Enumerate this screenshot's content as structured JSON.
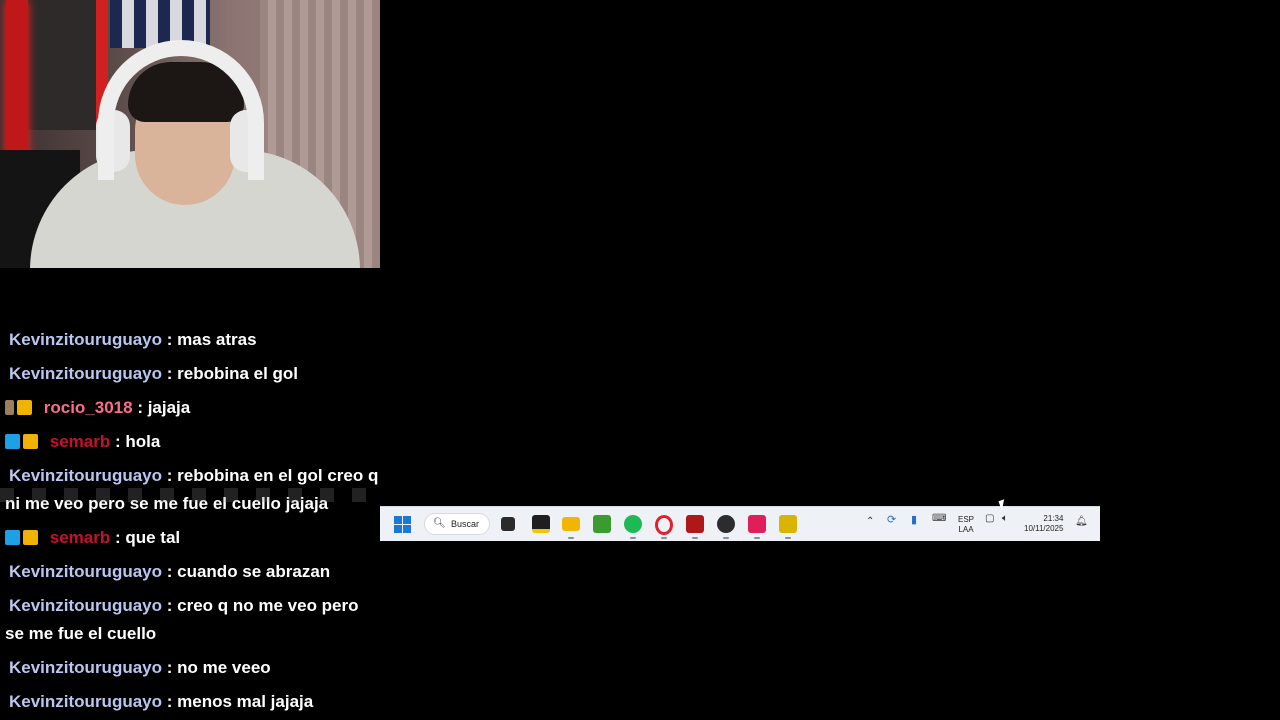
{
  "chat": {
    "messages": [
      {
        "user": "Kevinzitouruguayo",
        "text": ": mas atras"
      },
      {
        "user": "Kevinzitouruguayo",
        "text": ": rebobina el gol"
      },
      {
        "user": "rocio_3018",
        "text": ": jajaja"
      },
      {
        "user": "semarb",
        "text": ": hola"
      },
      {
        "user": "Kevinzitouruguayo",
        "text": ": rebobina en el gol creo q ni me veo pero se me fue el cuello jajaja"
      },
      {
        "user": "semarb",
        "text": ": que tal"
      },
      {
        "user": "Kevinzitouruguayo",
        "text": ": cuando se abrazan"
      },
      {
        "user": "Kevinzitouruguayo",
        "text": ": creo q no me veo pero se me fue el cuello"
      },
      {
        "user": "Kevinzitouruguayo",
        "text": ": no me veeo"
      },
      {
        "user": "Kevinzitouruguayo",
        "text": ": menos mal jajaja"
      }
    ]
  },
  "taskbar": {
    "search_label": "Buscar",
    "language": {
      "line1": "ESP",
      "line2": "LAA"
    },
    "clock": {
      "time": "21:34",
      "date": "10/11/2025"
    },
    "icons": [
      "windows-start-icon",
      "search-icon",
      "task-view-icon",
      "sticky-notes-icon",
      "file-explorer-icon",
      "minecraft-icon",
      "spotify-icon",
      "opera-icon",
      "game-app-icon",
      "obs-icon",
      "tiktok-icon",
      "app-icon",
      "chevron-up-icon",
      "sync-icon",
      "microphone-icon",
      "keyboard-icon",
      "network-icon",
      "volume-icon",
      "notification-icon"
    ]
  },
  "colors": {
    "user_default": "#b9c7f0",
    "user_pink": "#ff6b8b",
    "user_red": "#c8102e",
    "taskbar_bg": "#eef1f6"
  }
}
